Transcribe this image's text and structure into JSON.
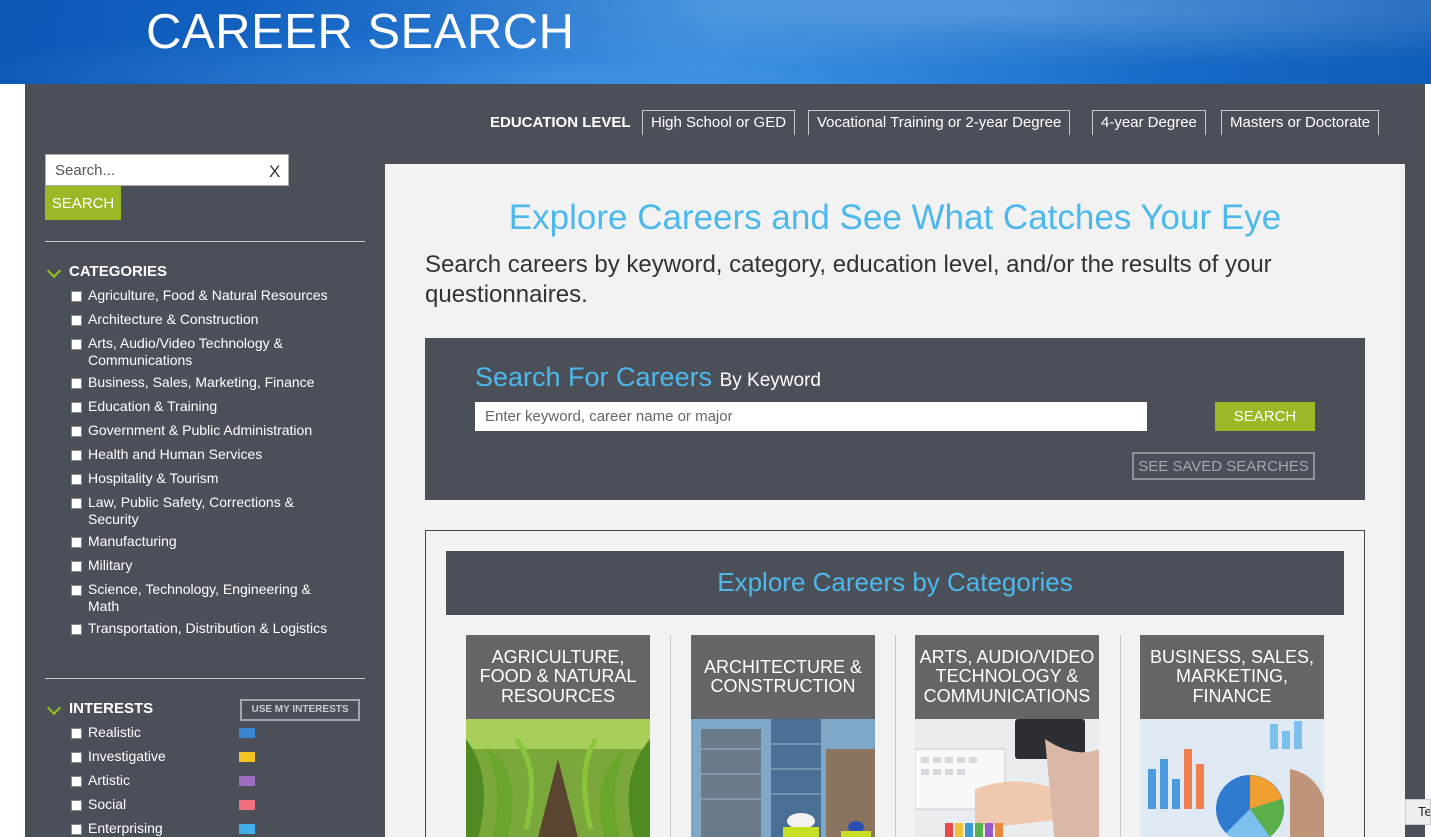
{
  "header": {
    "title": "CAREER SEARCH"
  },
  "education": {
    "label": "EDUCATION LEVEL",
    "options": [
      "High School or GED",
      "Vocational Training or 2-year Degree",
      "4-year Degree",
      "Masters or Doctorate"
    ]
  },
  "sidebar": {
    "search_placeholder": "Search...",
    "clear_label": "X",
    "search_button": "SEARCH",
    "categories_heading": "CATEGORIES",
    "categories": [
      "Agriculture, Food & Natural Resources",
      "Architecture & Construction",
      "Arts, Audio/Video Technology & Communications",
      "Business, Sales, Marketing, Finance",
      "Education & Training",
      "Government & Public Administration",
      "Health and Human Services",
      "Hospitality & Tourism",
      "Law, Public Safety, Corrections & Security",
      "Manufacturing",
      "Military",
      "Science, Technology, Engineering & Math",
      "Transportation, Distribution & Logistics"
    ],
    "interests_heading": "INTERESTS",
    "use_interests_button": "USE MY INTERESTS",
    "interests": [
      {
        "label": "Realistic",
        "color": "#3a86d1"
      },
      {
        "label": "Investigative",
        "color": "#f4c520"
      },
      {
        "label": "Artistic",
        "color": "#9d6bbf"
      },
      {
        "label": "Social",
        "color": "#f07080"
      },
      {
        "label": "Enterprising",
        "color": "#3fb0e8"
      }
    ]
  },
  "main": {
    "title": "Explore Careers and See What Catches Your Eye",
    "subtitle": "Search careers by keyword, category, education level, and/or the results of your questionnaires.",
    "keyword_search": {
      "title": "Search For Careers",
      "title_suffix": "By Keyword",
      "placeholder": "Enter keyword, career name or major",
      "button": "SEARCH",
      "saved_button": "SEE SAVED SEARCHES"
    },
    "categories_panel": {
      "heading": "Explore Careers by Categories",
      "tiles": [
        {
          "caption": "Agriculture, Food & Natural Resources"
        },
        {
          "caption": "Architecture & Construction"
        },
        {
          "caption": "Arts, Audio/Video Technology & Communications"
        },
        {
          "caption": "Business, Sales, Marketing, Finance"
        }
      ]
    }
  },
  "corner_tab": {
    "label": "Te"
  },
  "colors": {
    "accent_blue": "#4db8ec",
    "accent_green": "#9bb927",
    "panel_dark": "#4b4f58"
  }
}
